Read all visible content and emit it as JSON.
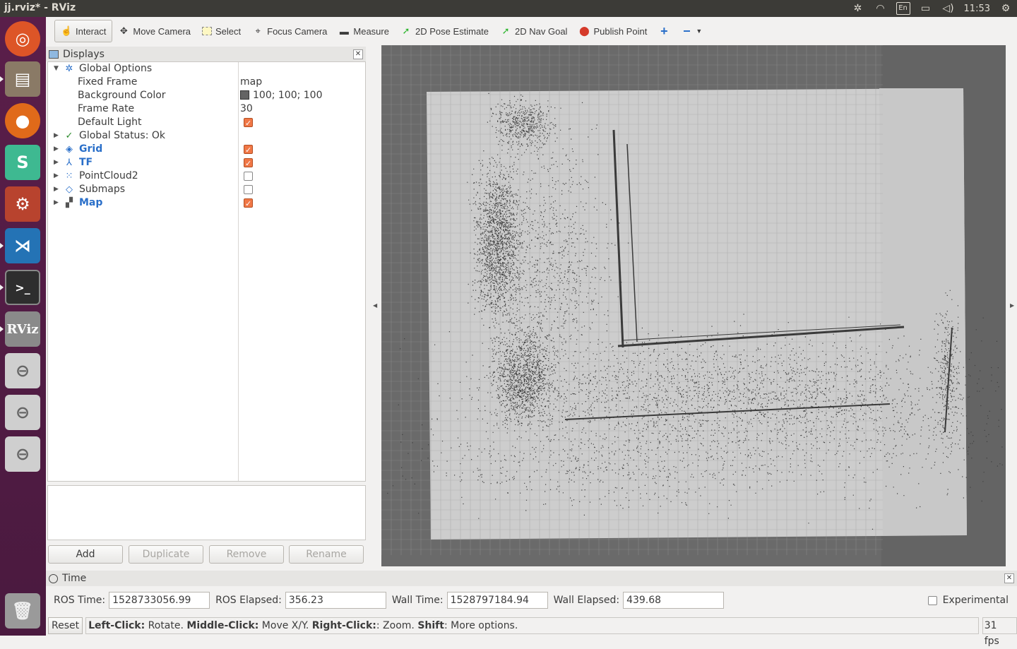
{
  "window": {
    "title": "jj.rviz* - RViz"
  },
  "tray": {
    "keyboard": "En",
    "time": "11:53"
  },
  "toolbar": {
    "interact": "Interact",
    "move_camera": "Move Camera",
    "select": "Select",
    "focus_camera": "Focus Camera",
    "measure": "Measure",
    "pose_estimate": "2D Pose Estimate",
    "nav_goal": "2D Nav Goal",
    "publish_point": "Publish Point"
  },
  "displays": {
    "title": "Displays",
    "global_options": "Global Options",
    "fixed_frame_label": "Fixed Frame",
    "fixed_frame_value": "map",
    "bg_color_label": "Background Color",
    "bg_color_value": "100; 100; 100",
    "frame_rate_label": "Frame Rate",
    "frame_rate_value": "30",
    "default_light_label": "Default Light",
    "global_status": "Global Status: Ok",
    "items": [
      {
        "label": "Grid",
        "enabled": true
      },
      {
        "label": "TF",
        "enabled": true
      },
      {
        "label": "PointCloud2",
        "enabled": false
      },
      {
        "label": "Submaps",
        "enabled": false
      },
      {
        "label": "Map",
        "enabled": true
      }
    ],
    "buttons": {
      "add": "Add",
      "duplicate": "Duplicate",
      "remove": "Remove",
      "rename": "Rename"
    }
  },
  "time": {
    "title": "Time",
    "ros_time_label": "ROS Time:",
    "ros_time_value": "1528733056.99",
    "ros_elapsed_label": "ROS Elapsed:",
    "ros_elapsed_value": "356.23",
    "wall_time_label": "Wall Time:",
    "wall_time_value": "1528797184.94",
    "wall_elapsed_label": "Wall Elapsed:",
    "wall_elapsed_value": "439.68",
    "experimental_label": "Experimental"
  },
  "status": {
    "reset": "Reset",
    "h1": "Left-Click:",
    "t1": " Rotate. ",
    "h2": "Middle-Click:",
    "t2": " Move X/Y. ",
    "h3": "Right-Click:",
    "t3": ": Zoom. ",
    "h4": "Shift",
    "t4": ": More options.",
    "fps": "31 fps"
  },
  "colors": {
    "background": "#646464",
    "map_light": "#cdcdcd",
    "occupied": "#3a3a3a",
    "accent_link": "#2a6fc9",
    "checkbox_on": "#f07746"
  }
}
